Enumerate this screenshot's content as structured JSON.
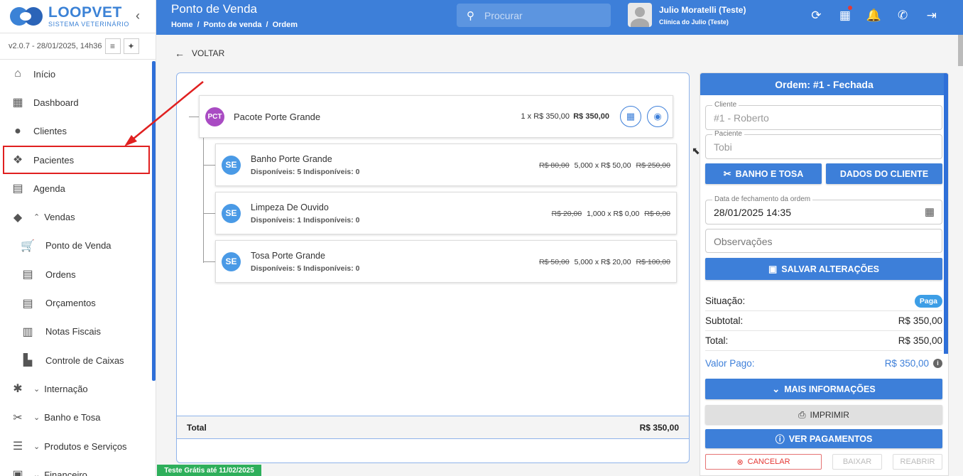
{
  "sidebar": {
    "logo_name": "LOOPVET",
    "logo_sub": "SISTEMA VETERINÁRIO",
    "version": "v2.0.7 - 28/01/2025, 14h36",
    "items": [
      {
        "label": "Início",
        "icon": "home-icon"
      },
      {
        "label": "Dashboard",
        "icon": "dashboard-icon"
      },
      {
        "label": "Clientes",
        "icon": "person-icon"
      },
      {
        "label": "Pacientes",
        "icon": "paw-icon"
      },
      {
        "label": "Agenda",
        "icon": "calendar-icon"
      },
      {
        "label": "Vendas",
        "icon": "tag-icon"
      },
      {
        "label": "Ponto de Venda",
        "icon": "cart-icon"
      },
      {
        "label": "Ordens",
        "icon": "list-icon"
      },
      {
        "label": "Orçamentos",
        "icon": "list-icon"
      },
      {
        "label": "Notas Fiscais",
        "icon": "document-icon"
      },
      {
        "label": "Controle de Caixas",
        "icon": "cashier-icon"
      },
      {
        "label": "Internação",
        "icon": "asterisk-icon"
      },
      {
        "label": "Banho e Tosa",
        "icon": "scissors-icon"
      },
      {
        "label": "Produtos e Serviços",
        "icon": "list-icon"
      },
      {
        "label": "Financeiro",
        "icon": "money-icon"
      }
    ]
  },
  "header": {
    "title": "Ponto de Venda",
    "breadcrumbs": [
      "Home",
      "Ponto de venda",
      "Ordem"
    ],
    "search_placeholder": "Procurar",
    "user_name": "Julio Moratelli (Teste)",
    "clinic": "Clínica do Julio (Teste)"
  },
  "main": {
    "back_label": "VOLTAR",
    "package": {
      "badge": "PCT",
      "name": "Pacote Porte Grande",
      "qty": "1 x R$ 350,00",
      "total": "R$ 350,00"
    },
    "items": [
      {
        "badge": "SE",
        "name": "Banho Porte Grande",
        "avail": "Disponíveis: 5  Indisponíveis: 0",
        "old_price": "R$ 80,00",
        "qty": "5,000 x R$ 50,00",
        "old_total": "R$ 250,00"
      },
      {
        "badge": "SE",
        "name": "Limpeza De Ouvido",
        "avail": "Disponíveis: 1  Indisponíveis: 0",
        "old_price": "R$ 20,00",
        "qty": "1,000 x R$ 0,00",
        "old_total": "R$ 0,00"
      },
      {
        "badge": "SE",
        "name": "Tosa Porte Grande",
        "avail": "Disponíveis: 5  Indisponíveis: 0",
        "old_price": "R$ 50,00",
        "qty": "5,000 x R$ 20,00",
        "old_total": "R$ 100,00"
      }
    ],
    "total_label": "Total",
    "total_value": "R$ 350,00"
  },
  "panel": {
    "title": "Ordem: #1 - Fechada",
    "client_label": "Cliente",
    "client_value": "#1 - Roberto",
    "patient_label": "Paciente",
    "patient_value": "Tobi",
    "btn_grooming": "BANHO E TOSA",
    "btn_client_data": "DADOS DO CLIENTE",
    "close_date_label": "Data de fechamento da ordem",
    "close_date_value": "28/01/2025 14:35",
    "notes_placeholder": "Observações",
    "btn_save": "SALVAR ALTERAÇÕES",
    "status_label": "Situação:",
    "status_value": "Paga",
    "subtotal_label": "Subtotal:",
    "subtotal_value": "R$ 350,00",
    "total_label": "Total:",
    "total_value": "R$ 350,00",
    "paid_label": "Valor Pago:",
    "paid_value": "R$ 350,00",
    "btn_more": "MAIS INFORMAÇÕES",
    "btn_print": "IMPRIMIR",
    "btn_payments": "VER PAGAMENTOS",
    "btn_cancel": "CANCELAR",
    "btn_lower": "BAIXAR",
    "btn_reopen": "REABRIR"
  },
  "trial_banner": "Teste Grátis até 11/02/2025",
  "colors": {
    "primary": "#3d7fd9",
    "highlight": "#e02020",
    "trial": "#2eaf5b",
    "package_badge": "#a94bc3"
  }
}
